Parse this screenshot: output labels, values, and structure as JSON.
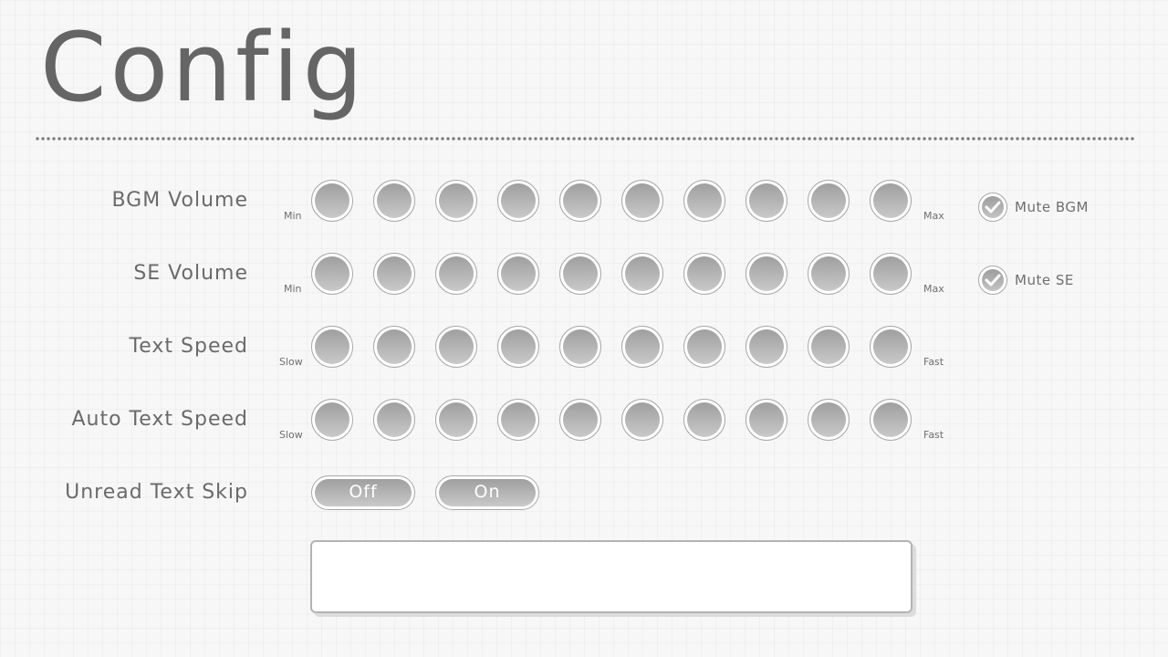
{
  "title": "Config",
  "settings": [
    {
      "id": "bgm-volume",
      "label": "BGM Volume",
      "min_label": "Min",
      "max_label": "Max",
      "steps": 10,
      "mute": {
        "label": "Mute BGM",
        "checked": true
      }
    },
    {
      "id": "se-volume",
      "label": "SE Volume",
      "min_label": "Min",
      "max_label": "Max",
      "steps": 10,
      "mute": {
        "label": "Mute SE",
        "checked": true
      }
    },
    {
      "id": "text-speed",
      "label": "Text Speed",
      "min_label": "Slow",
      "max_label": "Fast",
      "steps": 10
    },
    {
      "id": "auto-text-speed",
      "label": "Auto Text Speed",
      "min_label": "Slow",
      "max_label": "Fast",
      "steps": 10
    }
  ],
  "skip": {
    "label": "Unread Text Skip",
    "off_label": "Off",
    "on_label": "On"
  },
  "colors": {
    "text": "#666666",
    "button_fill": "#b5b5b5",
    "button_ring": "#a8a8a8"
  }
}
